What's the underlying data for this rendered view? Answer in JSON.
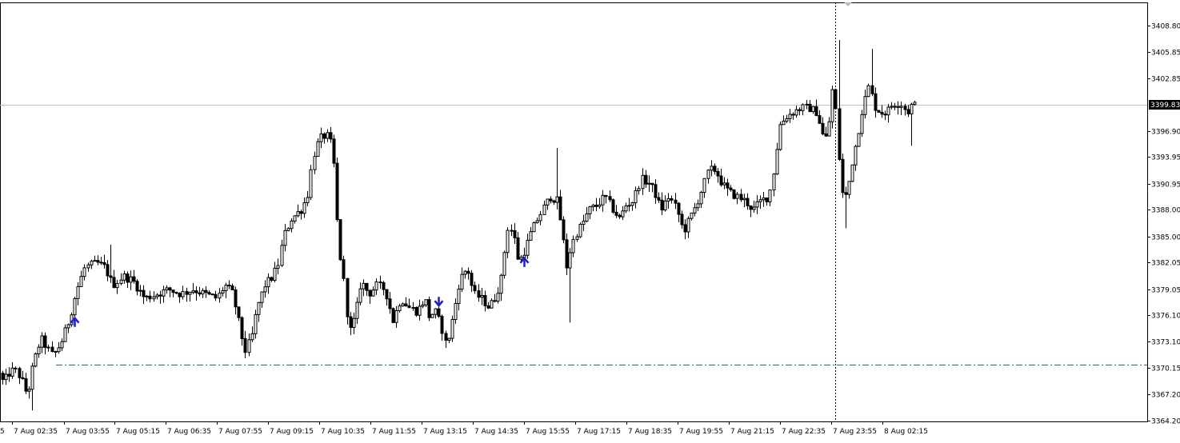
{
  "chart_data": {
    "type": "candlestick",
    "symbol_hidden": true,
    "y_ticks": [
      "3408.80",
      "3405.85",
      "3402.85",
      "3399.83",
      "3396.90",
      "3393.95",
      "3390.95",
      "3388.00",
      "3385.00",
      "3382.05",
      "3379.05",
      "3376.10",
      "3373.10",
      "3370.15",
      "3367.20",
      "3364.20"
    ],
    "ylim": [
      3364.2,
      3410.2
    ],
    "current_price": 3399.83,
    "current_price_label": "3399.83",
    "support_level": 3370.55,
    "x_tick_labels": [
      "5",
      "7 Aug 02:35",
      "7 Aug 03:55",
      "7 Aug 05:15",
      "7 Aug 06:35",
      "7 Aug 07:55",
      "7 Aug 09:15",
      "7 Aug 10:35",
      "7 Aug 11:55",
      "7 Aug 13:15",
      "7 Aug 14:35",
      "7 Aug 15:55",
      "7 Aug 17:15",
      "7 Aug 18:35",
      "7 Aug 19:55",
      "7 Aug 21:15",
      "7 Aug 22:35",
      "7 Aug 23:55",
      "8 Aug 02:15"
    ],
    "control_points": [
      [
        0,
        3370.2
      ],
      [
        8,
        3368.5
      ],
      [
        15,
        3369.5
      ],
      [
        22,
        3370.0
      ],
      [
        30,
        3369.0
      ],
      [
        38,
        3367.0
      ],
      [
        45,
        3370.5
      ],
      [
        55,
        3373.5
      ],
      [
        62,
        3372.5
      ],
      [
        70,
        3371.5
      ],
      [
        80,
        3373.0
      ],
      [
        90,
        3375.5
      ],
      [
        100,
        3379.0
      ],
      [
        110,
        3381.5
      ],
      [
        125,
        3382.0
      ],
      [
        135,
        3381.5
      ],
      [
        145,
        3379.5
      ],
      [
        158,
        3380.5
      ],
      [
        170,
        3380.0
      ],
      [
        185,
        3378.0
      ],
      [
        200,
        3378.5
      ],
      [
        215,
        3379.0
      ],
      [
        230,
        3378.5
      ],
      [
        245,
        3379.0
      ],
      [
        260,
        3378.5
      ],
      [
        275,
        3378.0
      ],
      [
        285,
        3379.5
      ],
      [
        295,
        3378.5
      ],
      [
        302,
        3375.5
      ],
      [
        310,
        3372.0
      ],
      [
        318,
        3373.5
      ],
      [
        325,
        3377.0
      ],
      [
        335,
        3379.5
      ],
      [
        345,
        3380.5
      ],
      [
        352,
        3382.0
      ],
      [
        358,
        3385.0
      ],
      [
        368,
        3387.0
      ],
      [
        380,
        3388.0
      ],
      [
        388,
        3389.5
      ],
      [
        395,
        3394.0
      ],
      [
        403,
        3396.0
      ],
      [
        412,
        3396.5
      ],
      [
        420,
        3395.0
      ],
      [
        425,
        3387.0
      ],
      [
        430,
        3382.0
      ],
      [
        435,
        3379.0
      ],
      [
        440,
        3374.0
      ],
      [
        448,
        3376.0
      ],
      [
        455,
        3380.0
      ],
      [
        465,
        3378.5
      ],
      [
        475,
        3379.5
      ],
      [
        485,
        3379.0
      ],
      [
        495,
        3375.5
      ],
      [
        505,
        3378.0
      ],
      [
        515,
        3377.0
      ],
      [
        525,
        3376.5
      ],
      [
        535,
        3378.0
      ],
      [
        540,
        3376.0
      ],
      [
        548,
        3376.5
      ],
      [
        555,
        3375.0
      ],
      [
        562,
        3372.5
      ],
      [
        570,
        3376.0
      ],
      [
        578,
        3380.0
      ],
      [
        588,
        3381.5
      ],
      [
        596,
        3378.5
      ],
      [
        605,
        3378.0
      ],
      [
        615,
        3377.0
      ],
      [
        622,
        3378.0
      ],
      [
        630,
        3380.0
      ],
      [
        638,
        3386.0
      ],
      [
        645,
        3385.5
      ],
      [
        652,
        3382.0
      ],
      [
        660,
        3383.5
      ],
      [
        668,
        3385.5
      ],
      [
        676,
        3387.0
      ],
      [
        685,
        3388.5
      ],
      [
        692,
        3389.5
      ],
      [
        700,
        3389.0
      ],
      [
        706,
        3386.0
      ],
      [
        712,
        3381.5
      ],
      [
        718,
        3384.0
      ],
      [
        725,
        3385.5
      ],
      [
        732,
        3386.5
      ],
      [
        740,
        3388.0
      ],
      [
        750,
        3388.5
      ],
      [
        760,
        3389.5
      ],
      [
        770,
        3388.0
      ],
      [
        778,
        3387.0
      ],
      [
        786,
        3388.5
      ],
      [
        795,
        3389.0
      ],
      [
        805,
        3391.5
      ],
      [
        815,
        3391.0
      ],
      [
        822,
        3390.0
      ],
      [
        830,
        3388.0
      ],
      [
        840,
        3389.5
      ],
      [
        850,
        3388.0
      ],
      [
        858,
        3385.5
      ],
      [
        866,
        3387.0
      ],
      [
        874,
        3388.5
      ],
      [
        882,
        3390.5
      ],
      [
        890,
        3392.5
      ],
      [
        898,
        3392.5
      ],
      [
        906,
        3391.0
      ],
      [
        915,
        3390.0
      ],
      [
        925,
        3389.5
      ],
      [
        935,
        3389.0
      ],
      [
        945,
        3388.0
      ],
      [
        955,
        3389.0
      ],
      [
        965,
        3389.5
      ],
      [
        972,
        3393.0
      ],
      [
        978,
        3397.5
      ],
      [
        986,
        3398.5
      ],
      [
        995,
        3399.0
      ],
      [
        1005,
        3399.5
      ],
      [
        1015,
        3399.5
      ],
      [
        1025,
        3399.0
      ],
      [
        1032,
        3396.5
      ],
      [
        1038,
        3396.0
      ],
      [
        1045,
        3402.0
      ],
      [
        1050,
        3398.0
      ],
      [
        1055,
        3390.0
      ],
      [
        1062,
        3389.5
      ],
      [
        1068,
        3393.0
      ],
      [
        1075,
        3396.0
      ],
      [
        1082,
        3399.5
      ],
      [
        1090,
        3402.0
      ],
      [
        1098,
        3399.5
      ],
      [
        1105,
        3399.0
      ],
      [
        1112,
        3399.0
      ],
      [
        1120,
        3400.0
      ],
      [
        1130,
        3400.0
      ],
      [
        1138,
        3399.0
      ],
      [
        1143,
        3399.8
      ]
    ],
    "arrows": [
      {
        "type": "buy",
        "bar_index": 22
      },
      {
        "type": "sell",
        "bar_index": 133
      },
      {
        "type": "buy",
        "bar_index": 159
      }
    ]
  },
  "colors": {
    "background": "#ffffff",
    "candle": "#000000",
    "bull_fill": "#ffffff",
    "bear_fill": "#000000",
    "grid_price_line": "#c0c0c0",
    "support_line": "#1f7a1f",
    "arrow": "#1f1fcc",
    "price_tag_bg": "#000000",
    "price_tag_text": "#ffffff"
  }
}
